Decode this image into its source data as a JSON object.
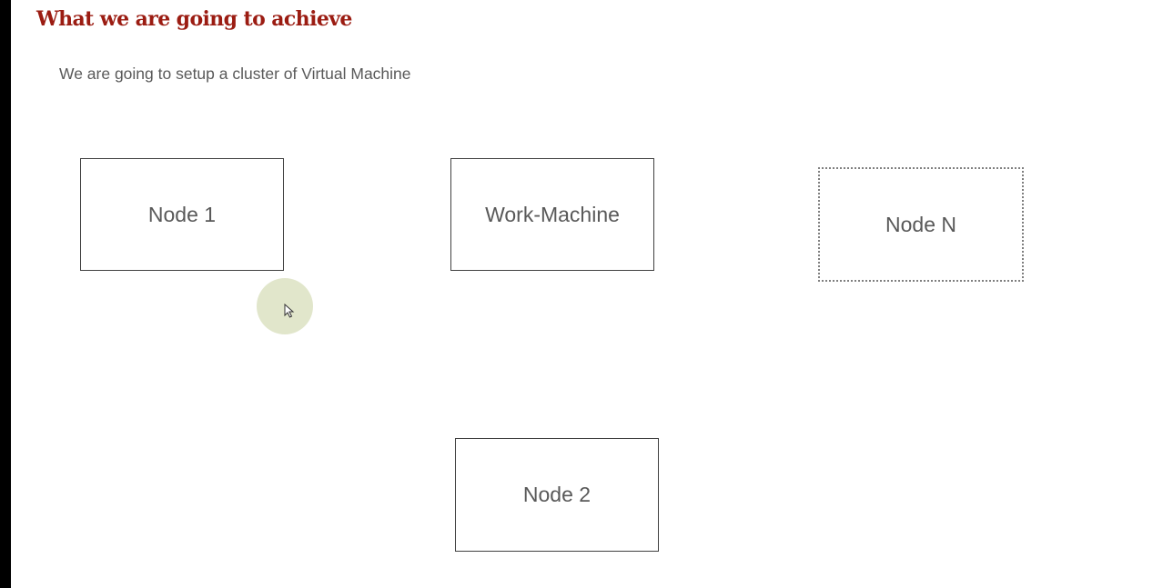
{
  "slide": {
    "title": "What we are going to achieve",
    "subtitle": "We are going to setup a cluster of Virtual Machine"
  },
  "diagram": {
    "nodes": {
      "node1": "Node 1",
      "work_machine": "Work-Machine",
      "node_n": "Node N",
      "node2": "Node 2"
    }
  },
  "colors": {
    "title": "#9b1c12",
    "text": "#595959",
    "box_border": "#404040",
    "cursor_highlight": "#c8d2a0"
  },
  "icons": {
    "cursor": "mouse-pointer-icon"
  }
}
